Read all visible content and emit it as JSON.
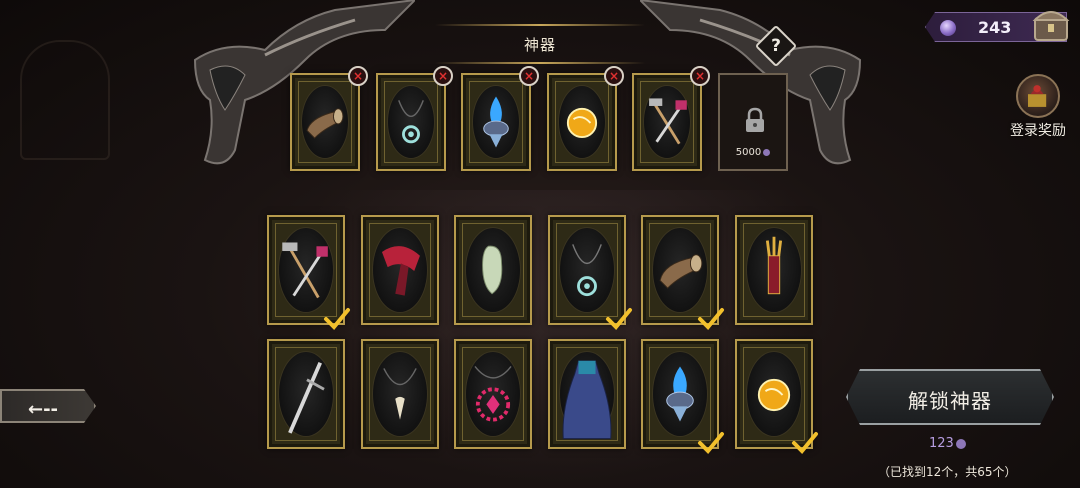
{
  "header": {
    "title": "神器",
    "help_label": "?"
  },
  "currency": {
    "amount": "243",
    "icon": "purple-gem-icon"
  },
  "login_reward": {
    "label": "登录奖励"
  },
  "equipped_slots": [
    {
      "item": "war-horn",
      "remove_label": "×"
    },
    {
      "item": "spiral-pendant",
      "remove_label": "×"
    },
    {
      "item": "blue-flame-lantern",
      "remove_label": "×"
    },
    {
      "item": "golden-orb",
      "remove_label": "×"
    },
    {
      "item": "hammer-and-pick",
      "remove_label": "×"
    }
  ],
  "locked_slot": {
    "cost": "5000"
  },
  "collection": {
    "row1": [
      {
        "item": "hammer-and-pick",
        "checked": true
      },
      {
        "item": "red-scarf",
        "checked": false
      },
      {
        "item": "pale-crystal",
        "checked": false
      },
      {
        "item": "spiral-pendant",
        "checked": true
      },
      {
        "item": "war-horn",
        "checked": true
      },
      {
        "item": "trident-scepter",
        "checked": false
      }
    ],
    "row2": [
      {
        "item": "silver-sword",
        "checked": false
      },
      {
        "item": "fang-necklace",
        "checked": false
      },
      {
        "item": "spiked-ruby-amulet",
        "checked": false
      },
      {
        "item": "blue-cloak",
        "checked": false
      },
      {
        "item": "blue-flame-lantern",
        "checked": true
      },
      {
        "item": "golden-orb",
        "checked": true
      }
    ]
  },
  "back_button": {
    "label": "←--"
  },
  "unlock": {
    "label": "解锁神器",
    "cost": "123",
    "found_text": "（已找到12个，共65个）"
  },
  "colors": {
    "gold_border": "#b69a4c",
    "card_fill": "#2e2a16",
    "check": "#f2c02c",
    "remove_x": "#e03030",
    "gem": "#8d77b8"
  }
}
